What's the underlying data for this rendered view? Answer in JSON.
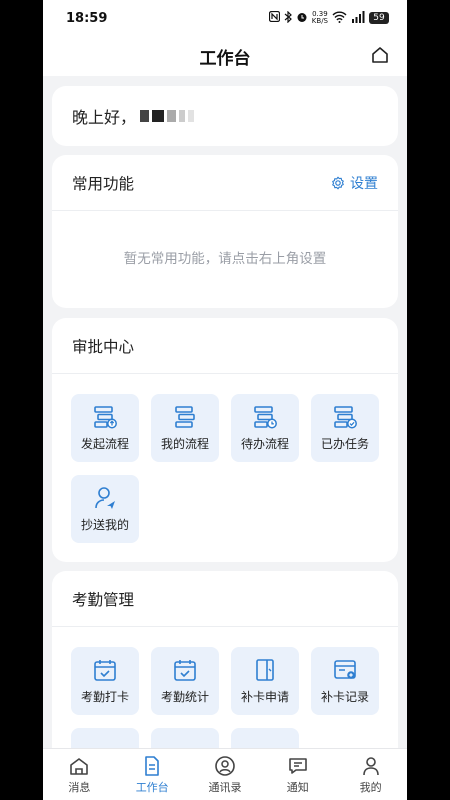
{
  "status": {
    "time": "18:59",
    "net_speed_value": "0.39",
    "net_speed_unit": "KB/S",
    "battery": "59"
  },
  "header": {
    "title": "工作台"
  },
  "greeting": {
    "text": "晚上好，"
  },
  "common": {
    "title": "常用功能",
    "settings_label": "设置",
    "empty_text": "暂无常用功能，请点击右上角设置"
  },
  "approval": {
    "title": "审批中心",
    "items": [
      {
        "label": "发起流程",
        "icon": "start-process-icon"
      },
      {
        "label": "我的流程",
        "icon": "my-process-icon"
      },
      {
        "label": "待办流程",
        "icon": "pending-process-icon"
      },
      {
        "label": "已办任务",
        "icon": "done-task-icon"
      },
      {
        "label": "抄送我的",
        "icon": "cc-me-icon"
      }
    ]
  },
  "attendance": {
    "title": "考勤管理",
    "items": [
      {
        "label": "考勤打卡",
        "icon": "clock-in-icon"
      },
      {
        "label": "考勤统计",
        "icon": "attendance-stats-icon"
      },
      {
        "label": "补卡申请",
        "icon": "makeup-apply-icon"
      },
      {
        "label": "补卡记录",
        "icon": "makeup-record-icon"
      }
    ]
  },
  "tabs": [
    {
      "label": "消息",
      "icon": "message-icon",
      "active": false
    },
    {
      "label": "工作台",
      "icon": "workbench-icon",
      "active": true
    },
    {
      "label": "通讯录",
      "icon": "contacts-icon",
      "active": false
    },
    {
      "label": "通知",
      "icon": "notice-icon",
      "active": false
    },
    {
      "label": "我的",
      "icon": "profile-icon",
      "active": false
    }
  ],
  "colors": {
    "accent": "#2f7fd1",
    "icon_blue": "#2f7fd1",
    "tile_bg": "#eaf1fb",
    "page_bg": "#f2f3f5"
  }
}
